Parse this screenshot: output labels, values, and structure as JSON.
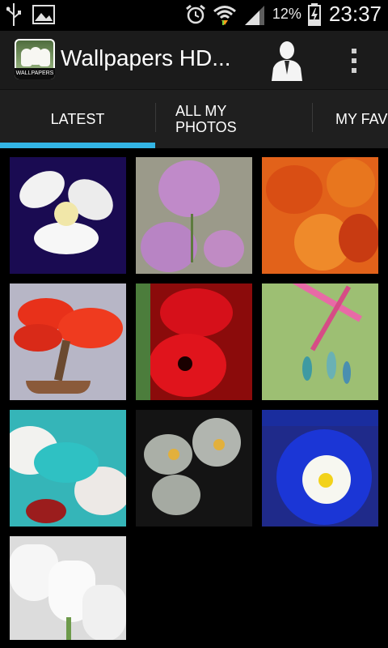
{
  "status_bar": {
    "battery_percent": "12%",
    "time": "23:37",
    "icons": [
      "usb-icon",
      "image-icon",
      "alarm-icon",
      "wifi-icon",
      "signal-icon",
      "battery-charging-icon"
    ]
  },
  "action_bar": {
    "app_icon_label": "WALLPAPERS",
    "title": "Wallpapers HD...",
    "user_icon": "user-icon",
    "overflow_icon": "overflow-menu-icon"
  },
  "tabs": {
    "items": [
      {
        "label": "LATEST",
        "active": true
      },
      {
        "label": "ALL MY PHOTOS",
        "line1": "ALL MY",
        "line2": "PHOTOS",
        "active": false
      },
      {
        "label": "MY FAV",
        "active": false
      }
    ],
    "indicator_color": "#33b5e5"
  },
  "gallery": {
    "items": [
      {
        "name": "purple-white-flower"
      },
      {
        "name": "purple-dahlias"
      },
      {
        "name": "orange-pansies"
      },
      {
        "name": "red-bonsai-tree"
      },
      {
        "name": "red-pansies"
      },
      {
        "name": "pink-hanging-flowers"
      },
      {
        "name": "turquoise-orchids"
      },
      {
        "name": "glass-flowers"
      },
      {
        "name": "blue-morning-glory"
      },
      {
        "name": "white-tulips"
      }
    ]
  }
}
